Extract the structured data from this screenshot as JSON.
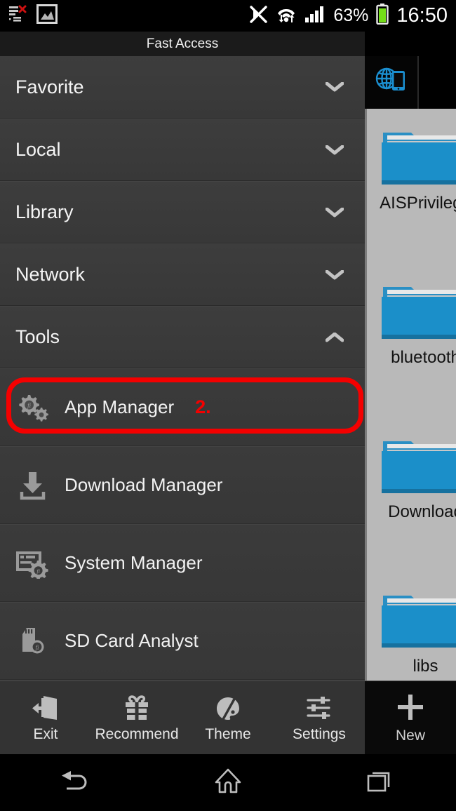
{
  "status_bar": {
    "icons_left": [
      "list-error-icon",
      "image-icon"
    ],
    "icons_right": [
      "bluetooth-off-icon",
      "wifi-icon",
      "signal-bars-icon",
      "battery-icon"
    ],
    "battery_percent": "63%",
    "clock": "16:50"
  },
  "title_bar": {
    "title": "Fast Access"
  },
  "drawer": {
    "groups": [
      {
        "label": "Favorite",
        "chevron": "chevron-down-icon",
        "expanded": false
      },
      {
        "label": "Local",
        "chevron": "chevron-down-icon",
        "expanded": false
      },
      {
        "label": "Library",
        "chevron": "chevron-down-icon",
        "expanded": false
      },
      {
        "label": "Network",
        "chevron": "chevron-down-icon",
        "expanded": false
      },
      {
        "label": "Tools",
        "chevron": "chevron-up-icon",
        "expanded": true
      }
    ],
    "tools": [
      {
        "label": "App Manager",
        "icon": "gears-icon",
        "marker": "2.",
        "highlighted": true
      },
      {
        "label": "Download Manager",
        "icon": "download-icon",
        "marker": "",
        "highlighted": false
      },
      {
        "label": "System Manager",
        "icon": "system-gear-icon",
        "marker": "",
        "highlighted": false
      },
      {
        "label": "SD Card Analyst",
        "icon": "sd-card-icon",
        "marker": "",
        "highlighted": false
      }
    ]
  },
  "toolbar": {
    "items": [
      {
        "label": "Exit",
        "icon": "exit-door-icon"
      },
      {
        "label": "Recommend",
        "icon": "gift-icon"
      },
      {
        "label": "Theme",
        "icon": "palette-icon"
      },
      {
        "label": "Settings",
        "icon": "sliders-icon"
      }
    ]
  },
  "right_panel": {
    "tab_icon": "globe-device-icon",
    "files": [
      {
        "name": "AISPrivilege",
        "icon": "folder-icon"
      },
      {
        "name": "bluetooth",
        "icon": "folder-icon"
      },
      {
        "name": "Download",
        "icon": "folder-icon"
      },
      {
        "name": "libs",
        "icon": "folder-icon"
      }
    ],
    "new_button": {
      "label": "New",
      "icon": "plus-icon"
    }
  },
  "nav_bar": {
    "buttons": [
      {
        "name": "back",
        "icon": "back-arrow-icon"
      },
      {
        "name": "home",
        "icon": "home-icon"
      },
      {
        "name": "recents",
        "icon": "recents-icon"
      }
    ]
  },
  "annotation": {
    "color": "#f40000",
    "step": "2.",
    "target": "App Manager"
  }
}
